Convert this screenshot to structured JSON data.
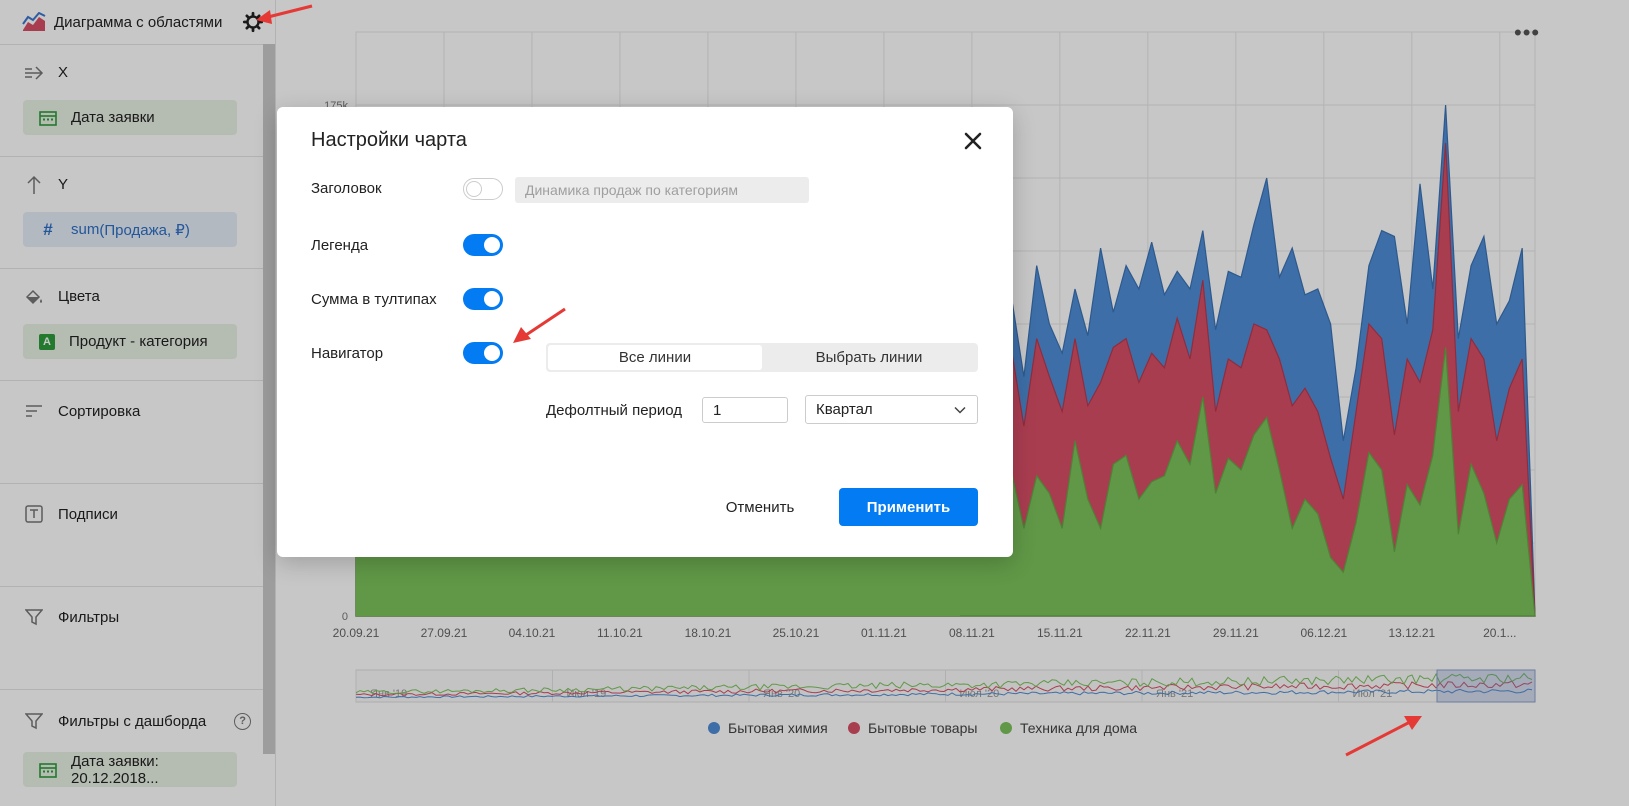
{
  "sidebar": {
    "title": "Диаграмма с областями",
    "sections": {
      "x": {
        "label": "X",
        "chip": "Дата заявки"
      },
      "y": {
        "label": "Y",
        "chip_fn": "sum",
        "chip_field": "(Продажа, ₽)"
      },
      "colors": {
        "label": "Цвета",
        "chip": "Продукт - категория"
      },
      "sort": {
        "label": "Сортировка"
      },
      "labels": {
        "label": "Подписи"
      },
      "filters": {
        "label": "Фильтры"
      },
      "dash_filters": {
        "label": "Фильтры с дашборда",
        "chip": "Дата заявки: 20.12.2018..."
      }
    }
  },
  "chart_data": {
    "type": "area",
    "stacked": true,
    "y_ticks": [
      "0",
      "175k"
    ],
    "x_ticks": [
      "20.09.21",
      "27.09.21",
      "04.10.21",
      "11.10.21",
      "18.10.21",
      "25.10.21",
      "01.11.21",
      "08.11.21",
      "15.11.21",
      "22.11.21",
      "29.11.21",
      "06.12.21",
      "13.12.21",
      "20.1..."
    ],
    "navigator_ticks": [
      "Янв '19",
      "Июл '19",
      "Янв '20",
      "Июл '20",
      "Янв '21",
      "Июл '21"
    ],
    "series": [
      {
        "name": "Бытовая химия",
        "color": "#4f8ed6"
      },
      {
        "name": "Бытовые товары",
        "color": "#d94f67"
      },
      {
        "name": "Техника для дома",
        "color": "#7cc35c"
      }
    ],
    "visible_tail": {
      "total": [
        95,
        72,
        88,
        100,
        110,
        82,
        120,
        100,
        90,
        112,
        96,
        126,
        104,
        120,
        112,
        128,
        110,
        118,
        112,
        132,
        98,
        118,
        116,
        134,
        150,
        116,
        126,
        110,
        112,
        100,
        60,
        85,
        120,
        132,
        130,
        100,
        148,
        112,
        175,
        95,
        120,
        130,
        100,
        108,
        126,
        0
      ],
      "red_top": [
        80,
        60,
        70,
        90,
        92,
        65,
        95,
        82,
        70,
        95,
        72,
        80,
        92,
        95,
        80,
        90,
        85,
        102,
        88,
        115,
        70,
        88,
        85,
        100,
        98,
        88,
        72,
        78,
        70,
        54,
        40,
        70,
        100,
        95,
        62,
        88,
        80,
        98,
        162,
        70,
        95,
        88,
        60,
        78,
        88,
        0
      ],
      "green_top": [
        45,
        35,
        38,
        55,
        50,
        30,
        48,
        42,
        30,
        60,
        40,
        30,
        52,
        55,
        40,
        46,
        48,
        60,
        52,
        75,
        42,
        54,
        50,
        62,
        68,
        50,
        30,
        40,
        35,
        20,
        15,
        32,
        56,
        50,
        22,
        45,
        38,
        55,
        92,
        28,
        52,
        42,
        25,
        40,
        45,
        0
      ]
    }
  },
  "dialog": {
    "title": "Настройки чарта",
    "rows": {
      "title_label": "Заголовок",
      "title_placeholder": "Динамика продаж по категориям",
      "legend_label": "Легенда",
      "tooltip_sum_label": "Сумма в тултипах",
      "navigator_label": "Навигатор"
    },
    "toggles": {
      "title": false,
      "legend": true,
      "tooltip_sum": true,
      "navigator": true
    },
    "navigator": {
      "options": [
        "Все линии",
        "Выбрать линии"
      ],
      "selected": "Все линии",
      "period_label": "Дефолтный период",
      "period_value": "1",
      "period_unit": "Квартал"
    },
    "buttons": {
      "cancel": "Отменить",
      "apply": "Применить"
    }
  },
  "colors": {
    "accent": "#027bf3",
    "arrow": "#e53935"
  }
}
